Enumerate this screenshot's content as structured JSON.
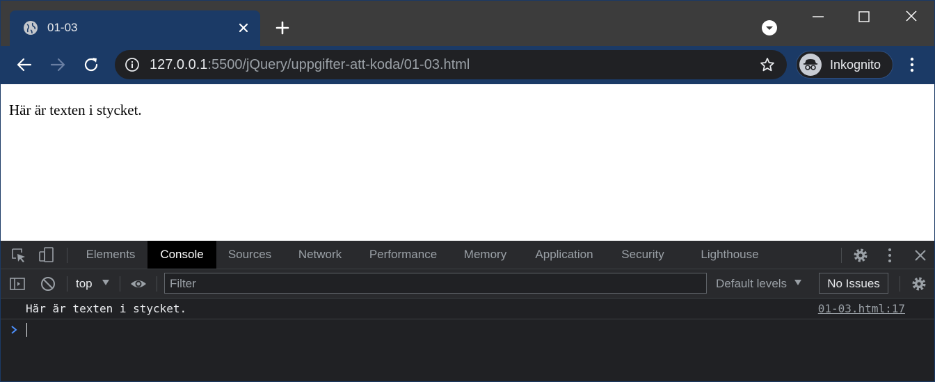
{
  "browser": {
    "tab": {
      "title": "01-03"
    },
    "url": {
      "host": "127.0.0.1",
      "path": ":5500/jQuery/uppgifter-att-koda/01-03.html"
    },
    "profile_label": "Inkognito",
    "icons": [
      "globe-icon",
      "close-icon",
      "plus-icon",
      "tab-search-icon",
      "minimize-icon",
      "maximize-icon",
      "window-close-icon",
      "back-arrow-icon",
      "forward-arrow-icon",
      "reload-icon",
      "info-icon",
      "star-icon",
      "incognito-icon",
      "kebab-menu-icon"
    ]
  },
  "page": {
    "paragraph": "Här är texten i stycket."
  },
  "devtools": {
    "tabs": [
      "Elements",
      "Console",
      "Sources",
      "Network",
      "Performance",
      "Memory",
      "Application",
      "Security",
      "Lighthouse"
    ],
    "active_tab": "Console",
    "console": {
      "context": "top",
      "filter_placeholder": "Filter",
      "levels": "Default levels",
      "issues_button": "No Issues",
      "logs": [
        {
          "message": "Här är texten i stycket.",
          "source": "01-03.html:17"
        }
      ]
    },
    "colors": {
      "prompt": "#4d90fe",
      "active_tab_bg": "#000000",
      "panel_bg": "#202124"
    }
  }
}
